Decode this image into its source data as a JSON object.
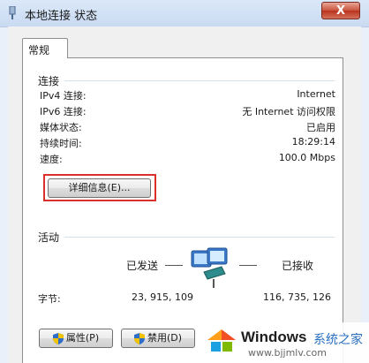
{
  "window": {
    "title": "本地连接 状态",
    "close_glyph": "X"
  },
  "tabs": [
    "常规"
  ],
  "connection": {
    "group_label": "连接",
    "rows": [
      {
        "label": "IPv4 连接:",
        "value": "Internet"
      },
      {
        "label": "IPv6 连接:",
        "value": "无 Internet 访问权限"
      },
      {
        "label": "媒体状态:",
        "value": "已启用"
      },
      {
        "label": "持续时间:",
        "value": "18:29:14"
      },
      {
        "label": "速度:",
        "value": "100.0 Mbps"
      }
    ],
    "details_button": "详细信息(E)..."
  },
  "activity": {
    "group_label": "活动",
    "sent_label": "已发送",
    "received_label": "已接收",
    "bytes_label": "字节:",
    "bytes_sent": "23, 915, 109",
    "bytes_received": "116, 735, 126"
  },
  "buttons": {
    "properties": "属性(P)",
    "disable": "禁用(D)"
  },
  "watermark": {
    "brand": "Windows",
    "cn_text": "系统之家",
    "url": "www.bjjmlv.com"
  },
  "colors": {
    "highlight": "#d9302c",
    "close": "#c9533d",
    "accent": "#2a6fc0"
  }
}
